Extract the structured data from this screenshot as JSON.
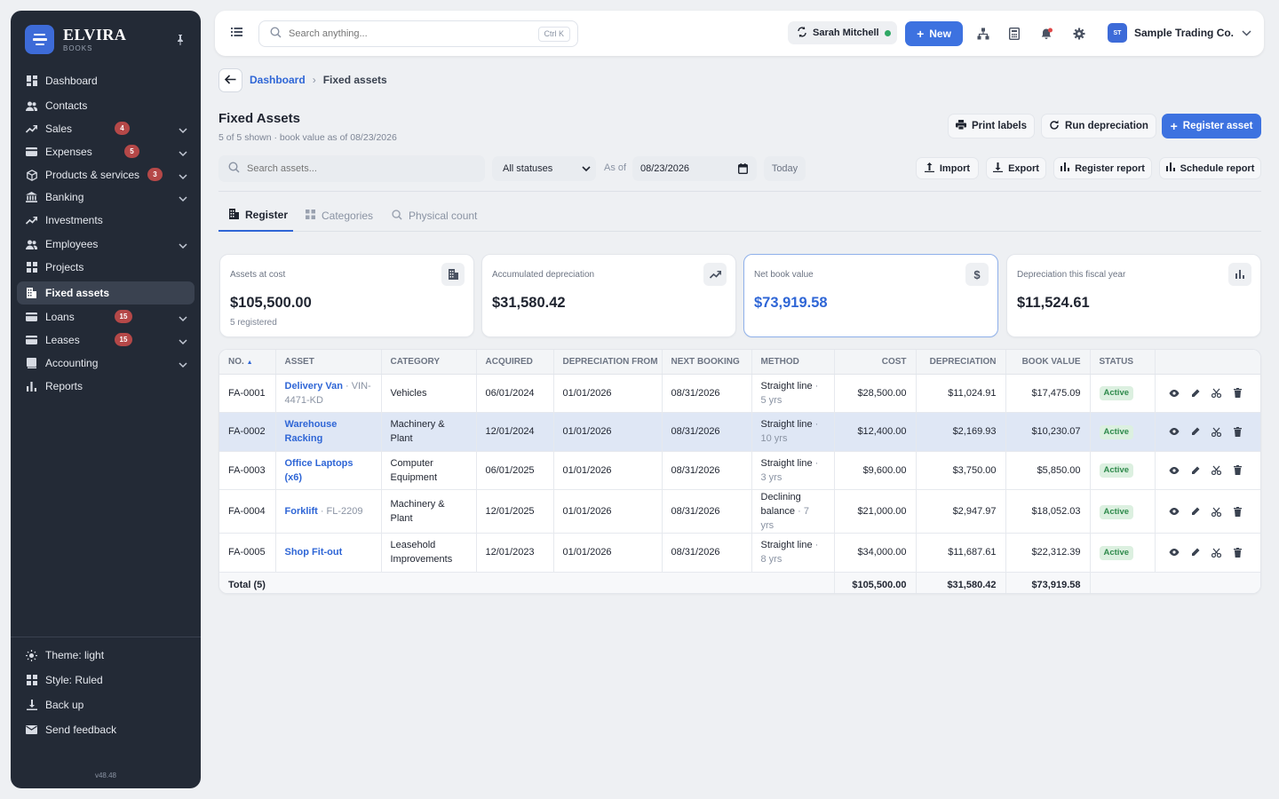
{
  "brand": {
    "name": "ELVIRA",
    "sub": "BOOKS"
  },
  "nav": [
    {
      "label": "Dashboard",
      "icon": "dashboard-icon"
    },
    {
      "label": "Contacts",
      "icon": "contacts-icon"
    },
    {
      "label": "Sales",
      "icon": "trend-icon",
      "badge": "4",
      "chevron": true
    },
    {
      "label": "Expenses",
      "icon": "card-icon",
      "badge": "5",
      "chevron": true
    },
    {
      "label": "Products & services",
      "icon": "box-icon",
      "badge": "3",
      "chevron": true
    },
    {
      "label": "Banking",
      "icon": "bank-icon",
      "chevron": true
    },
    {
      "label": "Investments",
      "icon": "trend-icon"
    },
    {
      "label": "Employees",
      "icon": "people-icon",
      "chevron": true
    },
    {
      "label": "Projects",
      "icon": "grid-icon"
    },
    {
      "label": "Fixed assets",
      "icon": "building-icon",
      "active": true
    },
    {
      "label": "Loans",
      "icon": "card-icon",
      "badge": "15",
      "chevron": true
    },
    {
      "label": "Leases",
      "icon": "card-icon",
      "badge": "15",
      "chevron": true
    },
    {
      "label": "Accounting",
      "icon": "book-icon",
      "chevron": true
    },
    {
      "label": "Reports",
      "icon": "bar-chart-icon"
    }
  ],
  "sidebar_bottom": {
    "theme": "Theme: light",
    "style": "Style: Ruled",
    "backup": "Back up",
    "feedback": "Send feedback",
    "version": "v48.48"
  },
  "topbar": {
    "search_placeholder": "Search anything...",
    "search_shortcut": "Ctrl K",
    "user": "Sarah Mitchell",
    "new_label": "New",
    "company_initials": "ST",
    "company": "Sample Trading Co."
  },
  "breadcrumb": {
    "parent": "Dashboard",
    "current": "Fixed assets"
  },
  "page": {
    "title": "Fixed Assets",
    "subtitle": "5 of 5 shown · book value as of 08/23/2026"
  },
  "actions": {
    "print": "Print labels",
    "run": "Run depreciation",
    "register": "Register asset",
    "import": "Import",
    "export": "Export",
    "register_report": "Register report",
    "schedule_report": "Schedule report"
  },
  "filters": {
    "search_placeholder": "Search assets...",
    "status": "All statuses",
    "as_of_label": "As of",
    "date": "08/23/2026",
    "today": "Today"
  },
  "tabs": [
    "Register",
    "Categories",
    "Physical count"
  ],
  "cards": [
    {
      "label": "Assets at cost",
      "value": "$105,500.00",
      "sub": "5 registered",
      "icon": "building-icon"
    },
    {
      "label": "Accumulated depreciation",
      "value": "$31,580.42",
      "icon": "trend-icon"
    },
    {
      "label": "Net book value",
      "value": "$73,919.58",
      "icon": "dollar-icon"
    },
    {
      "label": "Depreciation this fiscal year",
      "value": "$11,524.61",
      "icon": "bar-chart-icon"
    }
  ],
  "table": {
    "headers": [
      "NO.",
      "ASSET",
      "CATEGORY",
      "ACQUIRED",
      "DEPRECIATION FROM",
      "NEXT BOOKING",
      "METHOD",
      "COST",
      "DEPRECIATION",
      "BOOK VALUE",
      "STATUS",
      ""
    ],
    "rows": [
      {
        "no": "FA-0001",
        "asset": "Delivery Van",
        "asset_ref": " · VIN-4471-KD",
        "category": "Vehicles",
        "acquired": "06/01/2024",
        "dep_from": "01/01/2026",
        "next": "08/31/2026",
        "method": "Straight line",
        "method_sub": " · 5 yrs",
        "cost": "$28,500.00",
        "dep": "$11,024.91",
        "book": "$17,475.09",
        "status": "Active"
      },
      {
        "no": "FA-0002",
        "asset": "Warehouse Racking",
        "asset_ref": "",
        "category": "Machinery & Plant",
        "acquired": "12/01/2024",
        "dep_from": "01/01/2026",
        "next": "08/31/2026",
        "method": "Straight line",
        "method_sub": " · 10 yrs",
        "cost": "$12,400.00",
        "dep": "$2,169.93",
        "book": "$10,230.07",
        "status": "Active"
      },
      {
        "no": "FA-0003",
        "asset": "Office Laptops (x6)",
        "asset_ref": "",
        "category": "Computer Equipment",
        "acquired": "06/01/2025",
        "dep_from": "01/01/2026",
        "next": "08/31/2026",
        "method": "Straight line",
        "method_sub": " · 3 yrs",
        "cost": "$9,600.00",
        "dep": "$3,750.00",
        "book": "$5,850.00",
        "status": "Active"
      },
      {
        "no": "FA-0004",
        "asset": "Forklift",
        "asset_ref": " · FL-2209",
        "category": "Machinery & Plant",
        "acquired": "12/01/2025",
        "dep_from": "01/01/2026",
        "next": "08/31/2026",
        "method": "Declining balance",
        "method_sub": " · 7 yrs",
        "cost": "$21,000.00",
        "dep": "$2,947.97",
        "book": "$18,052.03",
        "status": "Active"
      },
      {
        "no": "FA-0005",
        "asset": "Shop Fit-out",
        "asset_ref": "",
        "category": "Leasehold Improvements",
        "acquired": "12/01/2023",
        "dep_from": "01/01/2026",
        "next": "08/31/2026",
        "method": "Straight line",
        "method_sub": " · 8 yrs",
        "cost": "$34,000.00",
        "dep": "$11,687.61",
        "book": "$22,312.39",
        "status": "Active"
      }
    ],
    "total": {
      "label": "Total (5)",
      "cost": "$105,500.00",
      "dep": "$31,580.42",
      "book": "$73,919.58"
    }
  }
}
